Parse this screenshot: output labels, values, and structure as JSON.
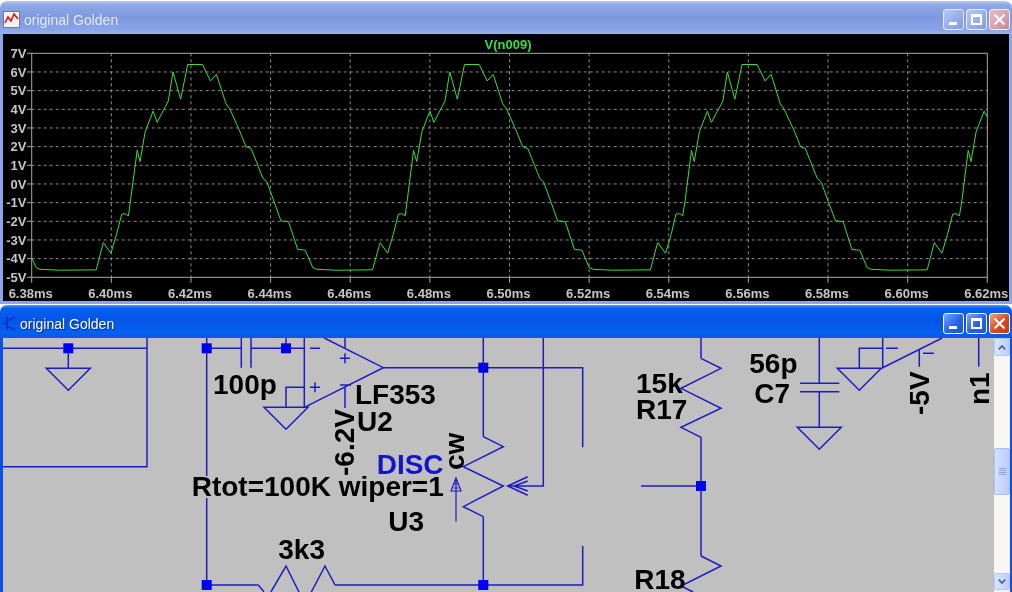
{
  "windows": [
    {
      "kind": "waveform",
      "title": "original Golden",
      "active": false,
      "chart_data": {
        "type": "line",
        "grid": true,
        "x": [
          6.38,
          6.3811,
          6.3821,
          6.3869,
          6.3962,
          6.398,
          6.3999,
          6.4013,
          6.4026,
          6.4034,
          6.4043,
          6.4048,
          6.4065,
          6.4072,
          6.4085,
          6.4105,
          6.4115,
          6.4143,
          6.4155,
          6.4174,
          6.4192,
          6.4229,
          6.4249,
          6.4264,
          6.4288,
          6.4298,
          6.4323,
          6.4338,
          6.4351,
          6.4381,
          6.4391,
          6.4408,
          6.4426,
          6.4445,
          6.4468,
          6.4487,
          6.4506,
          6.4516,
          6.4564,
          6.4656,
          6.4675,
          6.4694,
          6.4708,
          6.4721,
          6.4729,
          6.4738,
          6.4743,
          6.4759,
          6.4767,
          6.478,
          6.48,
          6.481,
          6.4838,
          6.485,
          6.4869,
          6.4887,
          6.4924,
          6.4944,
          6.4959,
          6.4983,
          6.4993,
          6.5018,
          6.5033,
          6.5046,
          6.5076,
          6.5086,
          6.5103,
          6.5121,
          6.514,
          6.5163,
          6.5182,
          6.52,
          6.521,
          6.5259,
          6.5354,
          6.5372,
          6.5392,
          6.5406,
          6.5418,
          6.5427,
          6.5435,
          6.5441,
          6.5457,
          6.5464,
          6.5477,
          6.5497,
          6.5507,
          6.5536,
          6.5547,
          6.5566,
          6.5584,
          6.5622,
          6.5642,
          6.5657,
          6.568,
          6.569,
          6.5716,
          6.5731,
          6.5743,
          6.5773,
          6.5783,
          6.58,
          6.5819,
          6.5838,
          6.586,
          6.588,
          6.5898,
          6.5908,
          6.5957,
          6.6049,
          6.6067,
          6.6086,
          6.61,
          6.6113,
          6.6121,
          6.613,
          6.6136,
          6.6152,
          6.6159,
          6.6172,
          6.6192,
          6.62
        ],
        "series": [
          {
            "name": "V(n009)",
            "color": "#3cdc3c",
            "values": [
              -3.94,
              -4.48,
              -4.57,
              -4.62,
              -4.6,
              -3.14,
              -3.71,
              -2.7,
              -1.62,
              -1.59,
              -1.71,
              -0.91,
              1.8,
              1.2,
              2.8,
              3.9,
              3.3,
              4.44,
              6.0,
              4.54,
              6.4,
              6.4,
              5.52,
              5.87,
              4.3,
              4.0,
              2.8,
              2.0,
              1.9,
              0.3,
              0.1,
              -0.91,
              -1.98,
              -2.02,
              -3.5,
              -3.55,
              -4.48,
              -4.57,
              -4.62,
              -4.6,
              -3.14,
              -3.71,
              -2.7,
              -1.62,
              -1.59,
              -1.71,
              -0.91,
              1.8,
              1.2,
              2.8,
              3.9,
              3.3,
              4.44,
              6.0,
              4.54,
              6.4,
              6.4,
              5.52,
              5.87,
              4.3,
              4.0,
              2.8,
              2.0,
              1.9,
              0.3,
              0.1,
              -0.91,
              -1.98,
              -2.02,
              -3.5,
              -3.55,
              -4.48,
              -4.57,
              -4.62,
              -4.6,
              -3.14,
              -3.71,
              -2.7,
              -1.62,
              -1.59,
              -1.71,
              -0.91,
              1.8,
              1.2,
              2.8,
              3.9,
              3.3,
              4.44,
              6.0,
              4.54,
              6.4,
              6.4,
              5.52,
              5.87,
              4.3,
              4.0,
              2.8,
              2.0,
              1.9,
              0.3,
              0.1,
              -0.91,
              -1.98,
              -2.02,
              -3.5,
              -3.55,
              -4.48,
              -4.57,
              -4.62,
              -4.6,
              -3.14,
              -3.71,
              -2.7,
              -1.62,
              -1.59,
              -1.71,
              -0.91,
              1.8,
              1.2,
              2.8,
              3.9,
              3.6
            ]
          }
        ],
        "xlim": [
          6.38,
          6.62
        ],
        "ylim": [
          -5,
          7
        ],
        "xticks": [
          {
            "value": 6.38,
            "label": "6.38ms"
          },
          {
            "value": 6.4,
            "label": "6.40ms"
          },
          {
            "value": 6.42,
            "label": "6.42ms"
          },
          {
            "value": 6.44,
            "label": "6.44ms"
          },
          {
            "value": 6.46,
            "label": "6.46ms"
          },
          {
            "value": 6.48,
            "label": "6.48ms"
          },
          {
            "value": 6.5,
            "label": "6.50ms"
          },
          {
            "value": 6.52,
            "label": "6.52ms"
          },
          {
            "value": 6.54,
            "label": "6.54ms"
          },
          {
            "value": 6.56,
            "label": "6.56ms"
          },
          {
            "value": 6.58,
            "label": "6.58ms"
          },
          {
            "value": 6.6,
            "label": "6.60ms"
          },
          {
            "value": 6.62,
            "label": "6.62ms"
          }
        ],
        "yticks": [
          {
            "value": 7,
            "label": "7V"
          },
          {
            "value": 6,
            "label": "6V"
          },
          {
            "value": 5,
            "label": "5V"
          },
          {
            "value": 4,
            "label": "4V"
          },
          {
            "value": 3,
            "label": "3V"
          },
          {
            "value": 2,
            "label": "2V"
          },
          {
            "value": 1,
            "label": "1V"
          },
          {
            "value": 0,
            "label": "0V"
          },
          {
            "value": -1,
            "label": "-1V"
          },
          {
            "value": -2,
            "label": "-2V"
          },
          {
            "value": -3,
            "label": "-3V"
          },
          {
            "value": -4,
            "label": "-4V"
          },
          {
            "value": -5,
            "label": "-5V"
          }
        ]
      }
    },
    {
      "kind": "schematic",
      "title": "original Golden",
      "active": true,
      "labels": [
        {
          "text": "100p",
          "kind": "attribute"
        },
        {
          "text": "LF353",
          "kind": "attribute"
        },
        {
          "text": "U2",
          "kind": "attribute"
        },
        {
          "text": "-6.2V",
          "kind": "attribute"
        },
        {
          "text": "DISC",
          "kind": "comment"
        },
        {
          "text": "cw",
          "kind": "attribute"
        },
        {
          "text": "Rtot=100K wiper=1",
          "kind": "attribute"
        },
        {
          "text": "U3",
          "kind": "attribute"
        },
        {
          "text": "3k3",
          "kind": "attribute"
        },
        {
          "text": "15k",
          "kind": "attribute"
        },
        {
          "text": "R17",
          "kind": "attribute"
        },
        {
          "text": "R18",
          "kind": "attribute"
        },
        {
          "text": "56p",
          "kind": "attribute"
        },
        {
          "text": "C7",
          "kind": "attribute"
        },
        {
          "text": "-5V",
          "kind": "attribute"
        },
        {
          "text": "n1",
          "kind": "attribute"
        }
      ]
    }
  ]
}
